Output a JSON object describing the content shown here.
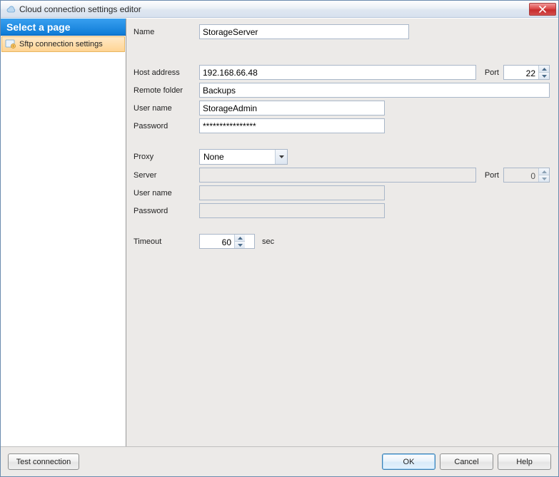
{
  "window": {
    "title": "Cloud connection settings editor"
  },
  "sidebar": {
    "header": "Select a page",
    "items": [
      {
        "label": "Sftp connection settings"
      }
    ]
  },
  "form": {
    "name_label": "Name",
    "name_value": "StorageServer",
    "host_label": "Host address",
    "host_value": "192.168.66.48",
    "port_label": "Port",
    "port_value": "22",
    "remote_label": "Remote folder",
    "remote_value": "Backups",
    "user_label": "User name",
    "user_value": "StorageAdmin",
    "password_label": "Password",
    "password_value": "****************",
    "proxy_label": "Proxy",
    "proxy_value": "None",
    "proxy_server_label": "Server",
    "proxy_server_value": "",
    "proxy_port_label": "Port",
    "proxy_port_value": "0",
    "proxy_user_label": "User name",
    "proxy_user_value": "",
    "proxy_password_label": "Password",
    "proxy_password_value": "",
    "timeout_label": "Timeout",
    "timeout_value": "60",
    "timeout_unit": "sec"
  },
  "footer": {
    "test_label": "Test connection",
    "ok_label": "OK",
    "cancel_label": "Cancel",
    "help_label": "Help"
  }
}
